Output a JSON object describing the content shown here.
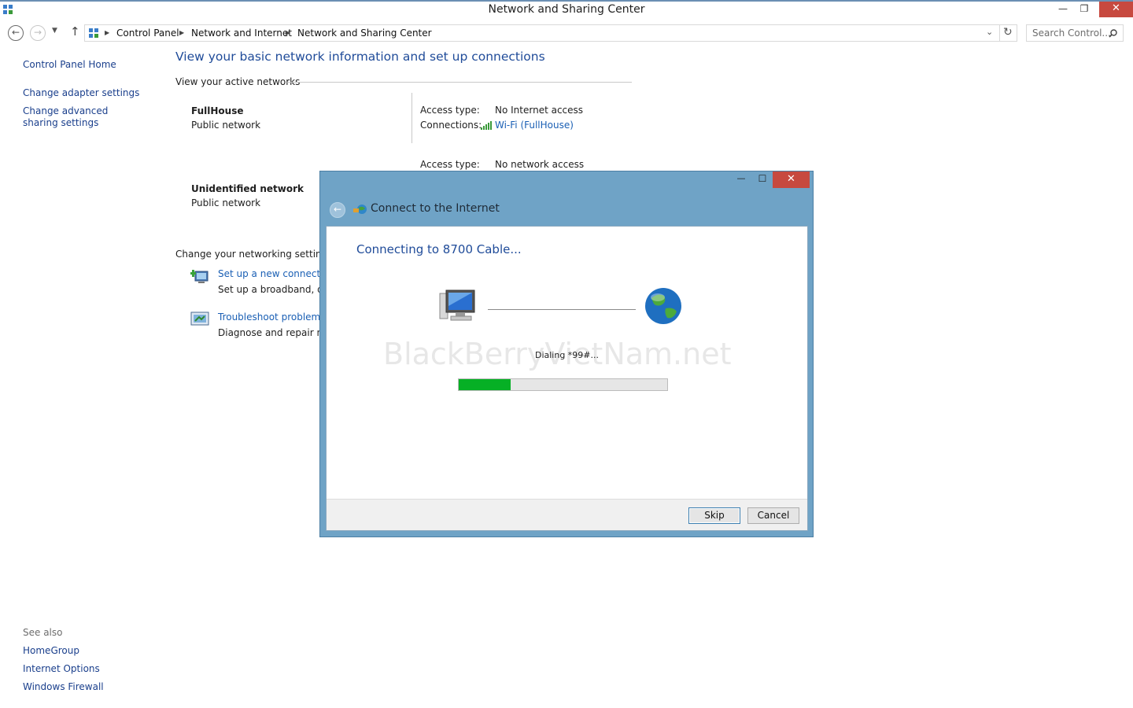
{
  "window": {
    "title": "Network and Sharing Center",
    "minimize": "—",
    "restore": "❐",
    "close": "✕"
  },
  "address": {
    "breadcrumbs": [
      "Control Panel",
      "Network and Internet",
      "Network and Sharing Center"
    ],
    "search_placeholder": "Search Control..."
  },
  "sidebar": {
    "home": "Control Panel Home",
    "links": [
      "Change adapter settings",
      "Change advanced sharing settings"
    ],
    "see_also_label": "See also",
    "see_also": [
      "HomeGroup",
      "Internet Options",
      "Windows Firewall"
    ]
  },
  "main": {
    "title": "View your basic network information and set up connections",
    "active_networks_label": "View your active networks",
    "networks": [
      {
        "name": "FullHouse",
        "type": "Public network",
        "access_label": "Access type:",
        "access": "No Internet access",
        "connections_label": "Connections:",
        "connection": "Wi-Fi (FullHouse)"
      },
      {
        "name": "Unidentified network",
        "type": "Public network",
        "access_label": "Access type:",
        "access": "No network access"
      }
    ],
    "settings_label": "Change your networking settings",
    "settings": [
      {
        "title": "Set up a new connection",
        "desc": "Set up a broadband, dial"
      },
      {
        "title": "Troubleshoot problems",
        "desc": "Diagnose and repair netw"
      }
    ]
  },
  "dialog": {
    "title": "Connect to the Internet",
    "heading": "Connecting to 8700 Cable...",
    "status": "Dialing *99#...",
    "progress": 0.25,
    "skip": "Skip",
    "cancel": "Cancel",
    "watermark": "BlackBerryVietNam.net",
    "minimize": "—",
    "maximize": "☐",
    "close": "✕"
  }
}
